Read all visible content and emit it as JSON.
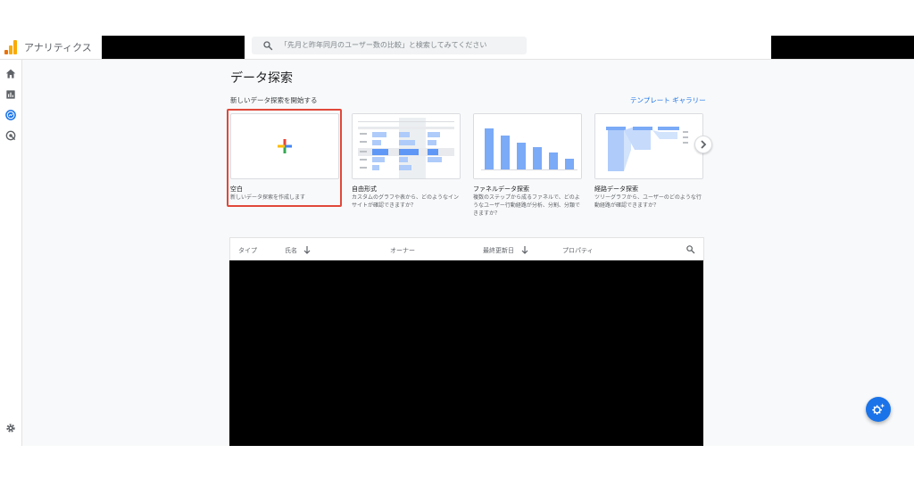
{
  "header": {
    "app_title": "アナリティクス",
    "search_placeholder": "「先月と昨年同月のユーザー数の比較」と検索してみてください"
  },
  "sidebar": {
    "items": [
      {
        "icon": "home-icon"
      },
      {
        "icon": "reports-icon"
      },
      {
        "icon": "explore-icon",
        "active": true
      },
      {
        "icon": "advertising-icon"
      }
    ],
    "settings_icon": "gear-icon"
  },
  "main": {
    "title": "データ探索",
    "subtitle": "新しいデータ探索を開始する",
    "gallery_link": "テンプレート ギャラリー",
    "cards": [
      {
        "title": "空白",
        "desc": "新しいデータ探索を作成します",
        "selected": true
      },
      {
        "title": "自由形式",
        "desc": "カスタムのグラフや表から、どのようなインサイトが確認できますか？"
      },
      {
        "title": "ファネルデータ探索",
        "desc": "複数のステップから成るファネルで、どのようなユーザー行動経路が分析、分割、分類できますか？"
      },
      {
        "title": "経路データ探索",
        "desc": "ツリーグラフから、ユーザーのどのような行動経路が確認できますか？"
      }
    ],
    "table": {
      "columns": [
        "タイプ",
        "氏名",
        "オーナー",
        "最終更新日",
        "プロパティ"
      ]
    }
  },
  "colors": {
    "accent": "#1a73e8",
    "highlight": "#e0483a",
    "logo_orange": "#f9ab00"
  }
}
